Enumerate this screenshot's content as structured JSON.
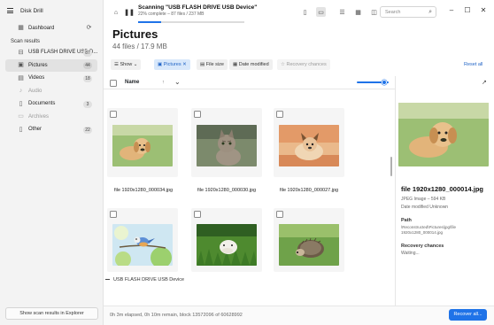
{
  "app": {
    "title": "Disk Drill"
  },
  "sidebar": {
    "dashboard_label": "Dashboard",
    "section_title": "Scan results",
    "items": [
      {
        "label": "USB FLASH DRIVE USB D...",
        "count": "87",
        "icon": "drive-icon"
      },
      {
        "label": "Pictures",
        "count": "44",
        "icon": "picture-icon"
      },
      {
        "label": "Videos",
        "count": "18",
        "icon": "video-icon"
      },
      {
        "label": "Audio",
        "count": "",
        "icon": "audio-icon"
      },
      {
        "label": "Documents",
        "count": "3",
        "icon": "document-icon"
      },
      {
        "label": "Archives",
        "count": "",
        "icon": "archive-icon"
      },
      {
        "label": "Other",
        "count": "22",
        "icon": "other-icon"
      }
    ],
    "bottom_button": "Show scan results in Explorer"
  },
  "titlebar": {
    "scan_title": "Scanning \"USB FLASH DRIVE USB Device\"",
    "scan_sub": "22% complete – 87 files / 237 MB",
    "progress_fraction": 0.22,
    "search_placeholder": "Search"
  },
  "header": {
    "title": "Pictures",
    "subtitle": "44 files / 17.9 MB"
  },
  "filters": {
    "show": "Show",
    "pictures": "Pictures",
    "file_size": "File size",
    "date_modified": "Date modified",
    "recovery_chances": "Recovery chances",
    "reset": "Reset all"
  },
  "list": {
    "name_header": "Name",
    "sort_indicator": "↑"
  },
  "tiles": [
    {
      "name": "file 1920x1280_000034.jpg",
      "art": "puppy"
    },
    {
      "name": "file 1920x1280_000030.jpg",
      "art": "cat"
    },
    {
      "name": "file 1920x1280_000027.jpg",
      "art": "dog"
    },
    {
      "name": "",
      "art": "bird"
    },
    {
      "name": "",
      "art": "hamster"
    },
    {
      "name": "",
      "art": "hedgehog"
    }
  ],
  "group_label": "USB FLASH DRIVE USB Device",
  "preview": {
    "name": "file 1920x1280_000014.jpg",
    "type": "JPEG Image – 594 KB",
    "date": "Date modified Unknown",
    "path_label": "Path",
    "path": "\\Reconstructed\\Pictures\\jpg\\file 1920x1280_000014.jpg",
    "recovery_label": "Recovery chances",
    "recovery_value": "Waiting..."
  },
  "status": {
    "text": "0h 3m elapsed, 0h 10m remain, block 13572096 of 60628992",
    "recover_button": "Recover all..."
  }
}
